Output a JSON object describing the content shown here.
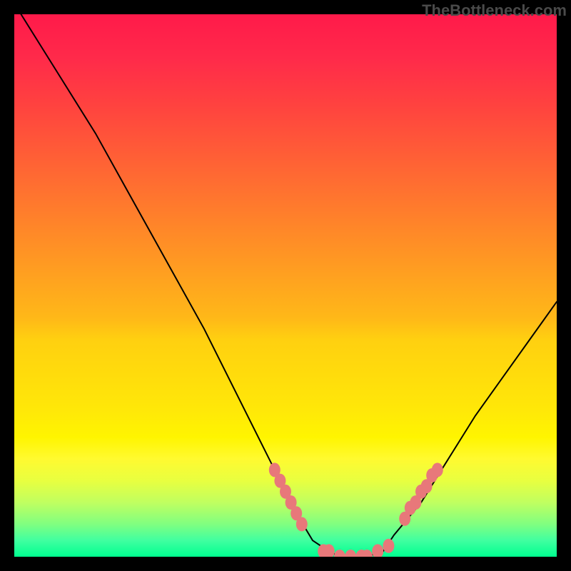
{
  "watermark": "TheBottleneck.com",
  "colors": {
    "background": "#000000",
    "curve": "#000000",
    "marker": "#e8787a",
    "gradient_top": "#ff1a4a",
    "gradient_bottom": "#00ff90"
  },
  "chart_data": {
    "type": "line",
    "title": "",
    "xlabel": "",
    "ylabel": "",
    "xlim": [
      0,
      100
    ],
    "ylim": [
      0,
      100
    ],
    "x": [
      0,
      5,
      10,
      15,
      20,
      25,
      30,
      35,
      40,
      45,
      50,
      52,
      55,
      58,
      60,
      62,
      65,
      68,
      70,
      75,
      80,
      85,
      90,
      95,
      100
    ],
    "values": [
      102,
      94,
      86,
      78,
      69,
      60,
      51,
      42,
      32,
      22,
      12,
      8,
      3,
      1,
      0,
      0,
      0,
      1,
      4,
      10,
      18,
      26,
      33,
      40,
      47
    ],
    "series": [
      {
        "name": "bottleneck-curve",
        "x": [
          0,
          5,
          10,
          15,
          20,
          25,
          30,
          35,
          40,
          45,
          50,
          52,
          55,
          58,
          60,
          62,
          65,
          68,
          70,
          75,
          80,
          85,
          90,
          95,
          100
        ],
        "y": [
          102,
          94,
          86,
          78,
          69,
          60,
          51,
          42,
          32,
          22,
          12,
          8,
          3,
          1,
          0,
          0,
          0,
          1,
          4,
          10,
          18,
          26,
          33,
          40,
          47
        ]
      }
    ],
    "markers": {
      "left_cluster": [
        {
          "x": 48,
          "y": 16
        },
        {
          "x": 49,
          "y": 14
        },
        {
          "x": 50,
          "y": 12
        },
        {
          "x": 51,
          "y": 10
        },
        {
          "x": 52,
          "y": 8
        },
        {
          "x": 53,
          "y": 6
        }
      ],
      "bottom_cluster": [
        {
          "x": 57,
          "y": 1
        },
        {
          "x": 58,
          "y": 1
        },
        {
          "x": 60,
          "y": 0
        },
        {
          "x": 62,
          "y": 0
        },
        {
          "x": 64,
          "y": 0
        },
        {
          "x": 65,
          "y": 0
        },
        {
          "x": 67,
          "y": 1
        },
        {
          "x": 69,
          "y": 2
        }
      ],
      "right_cluster": [
        {
          "x": 72,
          "y": 7
        },
        {
          "x": 73,
          "y": 9
        },
        {
          "x": 74,
          "y": 10
        },
        {
          "x": 75,
          "y": 12
        },
        {
          "x": 76,
          "y": 13
        },
        {
          "x": 77,
          "y": 15
        },
        {
          "x": 78,
          "y": 16
        }
      ]
    },
    "grid": false,
    "legend": false
  }
}
